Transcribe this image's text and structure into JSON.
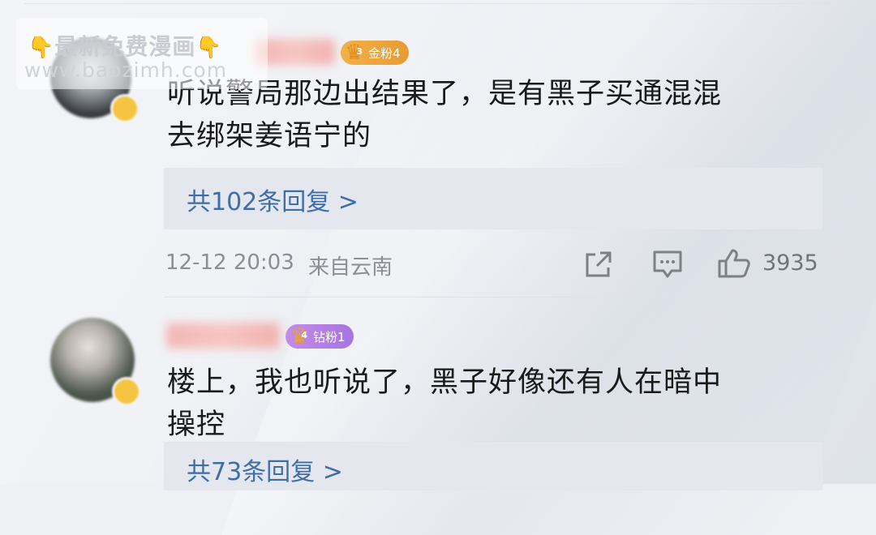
{
  "watermark": {
    "line1": "最新免费漫画",
    "line2": "www.baozimh.com",
    "hand_left": "👇",
    "hand_right": "👇"
  },
  "comments": [
    {
      "fan_badge": {
        "label": "金粉4",
        "level": "3",
        "color": "#f0b24a"
      },
      "text_line1": "听说警局那边出结果了，是有黑子买通混混",
      "text_line2": "去绑架姜语宁的",
      "replies": "共102条回复 >",
      "time": "12-12 20:03",
      "location": "来自云南",
      "likes": "3935"
    },
    {
      "fan_badge": {
        "label": "钻粉1",
        "level": "4",
        "color": "#b07de3"
      },
      "text_line1": "楼上，我也听说了，黑子好像还有人在暗中",
      "text_line2": "操控",
      "replies": "共73条回复 >"
    }
  ]
}
